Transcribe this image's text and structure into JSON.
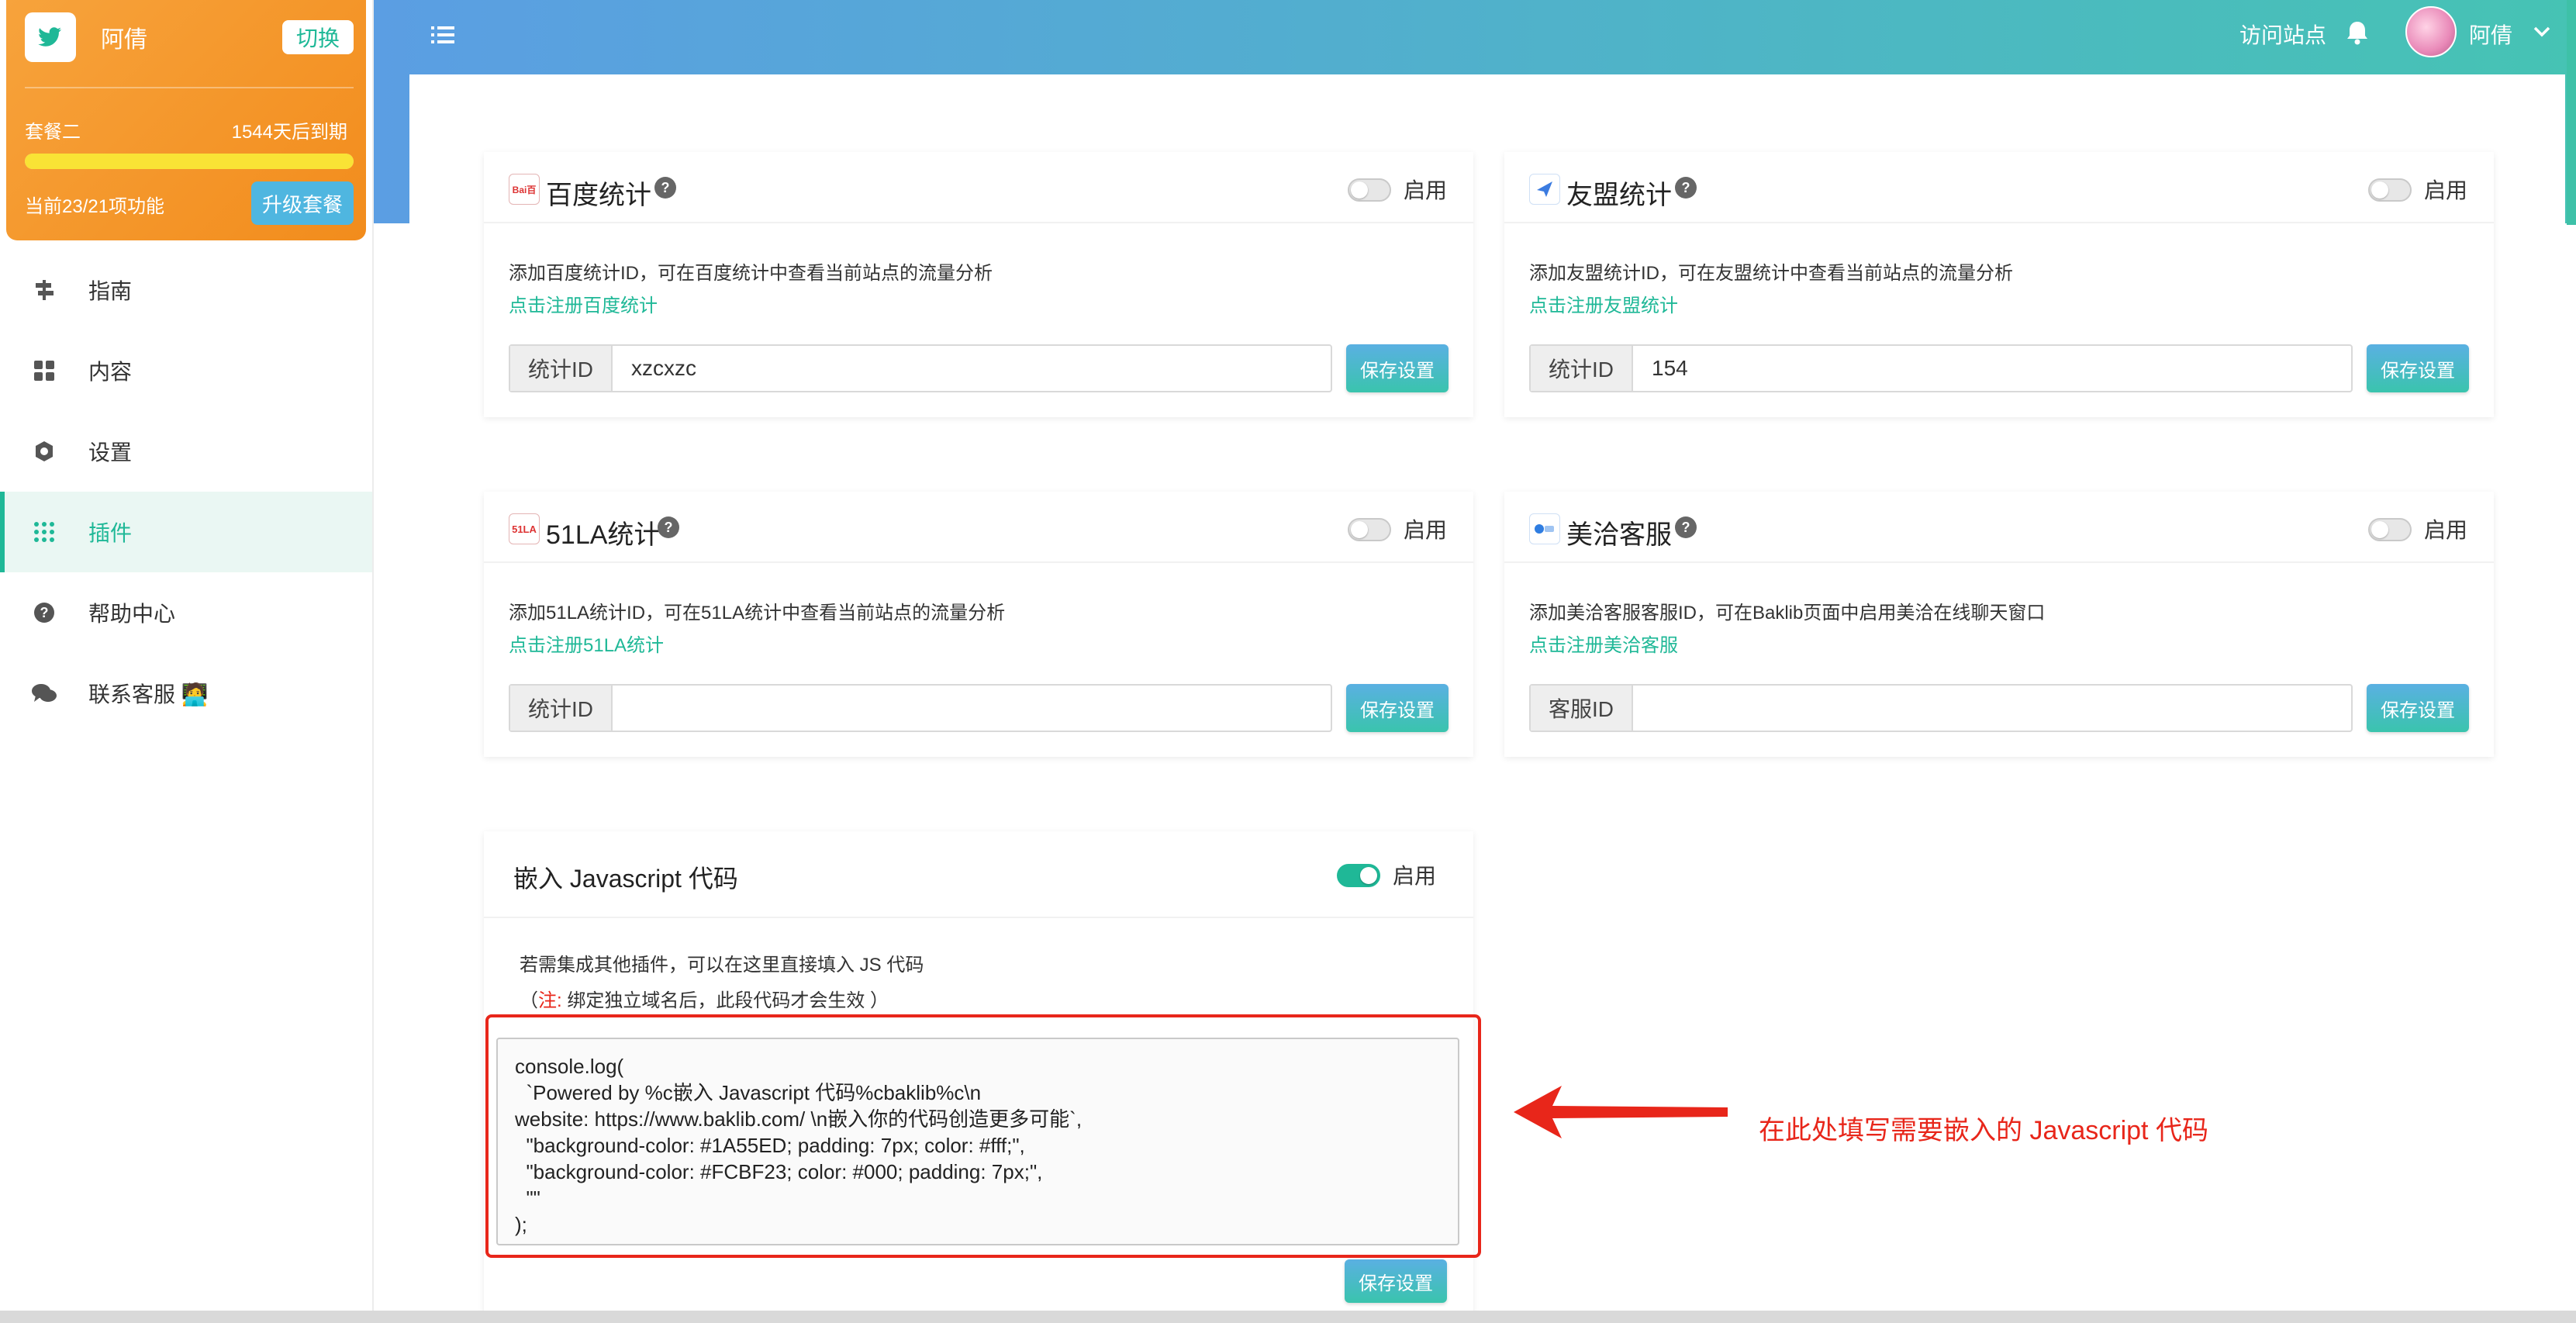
{
  "plan": {
    "name": "阿倩",
    "switch_label": "切换",
    "title": "套餐二",
    "expire": "1544天后到期",
    "usage": "当前23/21项功能",
    "progress": 1.0,
    "upgrade_label": "升级套餐"
  },
  "nav": {
    "items": [
      {
        "label": "指南",
        "icon": "signpost-icon"
      },
      {
        "label": "内容",
        "icon": "grid-icon"
      },
      {
        "label": "设置",
        "icon": "gear-icon"
      },
      {
        "label": "插件",
        "icon": "apps-icon",
        "active": true
      },
      {
        "label": "帮助中心",
        "icon": "help-icon"
      },
      {
        "label": "联系客服 🧑‍💻",
        "icon": "chat-icon"
      }
    ]
  },
  "header": {
    "visit_label": "访问站点",
    "user_name": "阿倩"
  },
  "plugins": {
    "baidu": {
      "title": "百度统计",
      "toggle_label": "启用",
      "enabled": false,
      "desc": "添加百度统计ID，可在百度统计中查看当前站点的流量分析",
      "link": "点击注册百度统计",
      "input_label": "统计ID",
      "input_value": "xzcxzc",
      "save_label": "保存设置"
    },
    "umeng": {
      "title": "友盟统计",
      "toggle_label": "启用",
      "enabled": false,
      "desc": "添加友盟统计ID，可在友盟统计中查看当前站点的流量分析",
      "link": "点击注册友盟统计",
      "input_label": "统计ID",
      "input_value": "154",
      "save_label": "保存设置"
    },
    "la51": {
      "title": "51LA统计",
      "toggle_label": "启用",
      "enabled": false,
      "desc": "添加51LA统计ID，可在51LA统计中查看当前站点的流量分析",
      "link": "点击注册51LA统计",
      "input_label": "统计ID",
      "input_value": "",
      "save_label": "保存设置"
    },
    "meiqia": {
      "title": "美洽客服",
      "toggle_label": "启用",
      "enabled": false,
      "desc": "添加美洽客服客服ID，可在Baklib页面中启用美洽在线聊天窗口",
      "link": "点击注册美洽客服",
      "input_label": "客服ID",
      "input_value": "",
      "save_label": "保存设置"
    },
    "js": {
      "title": "嵌入 Javascript 代码",
      "toggle_label": "启用",
      "enabled": true,
      "desc": "若需集成其他插件，可以在这里直接填入 JS 代码",
      "note_open": "（",
      "note_label": "注:",
      "note_text": " 绑定独立域名后，此段代码才会生效 ）",
      "code": "console.log(\n  `Powered by %c嵌入 Javascript 代码%cbaklib%c\\n\nwebsite: https://www.baklib.com/ \\n嵌入你的代码创造更多可能`,\n  \"background-color: #1A55ED; padding: 7px; color: #fff;\",\n  \"background-color: #FCBF23; color: #000; padding: 7px;\",\n  \"\"\n);",
      "save_label": "保存设置"
    }
  },
  "annotation": {
    "text": "在此处填写需要嵌入的 Javascript 代码",
    "color": "#e8261a"
  },
  "colors": {
    "accent": "#1fb897",
    "plan_orange": "#f39a2d",
    "header_start": "#5b9ee3",
    "header_end": "#46c3b4"
  }
}
